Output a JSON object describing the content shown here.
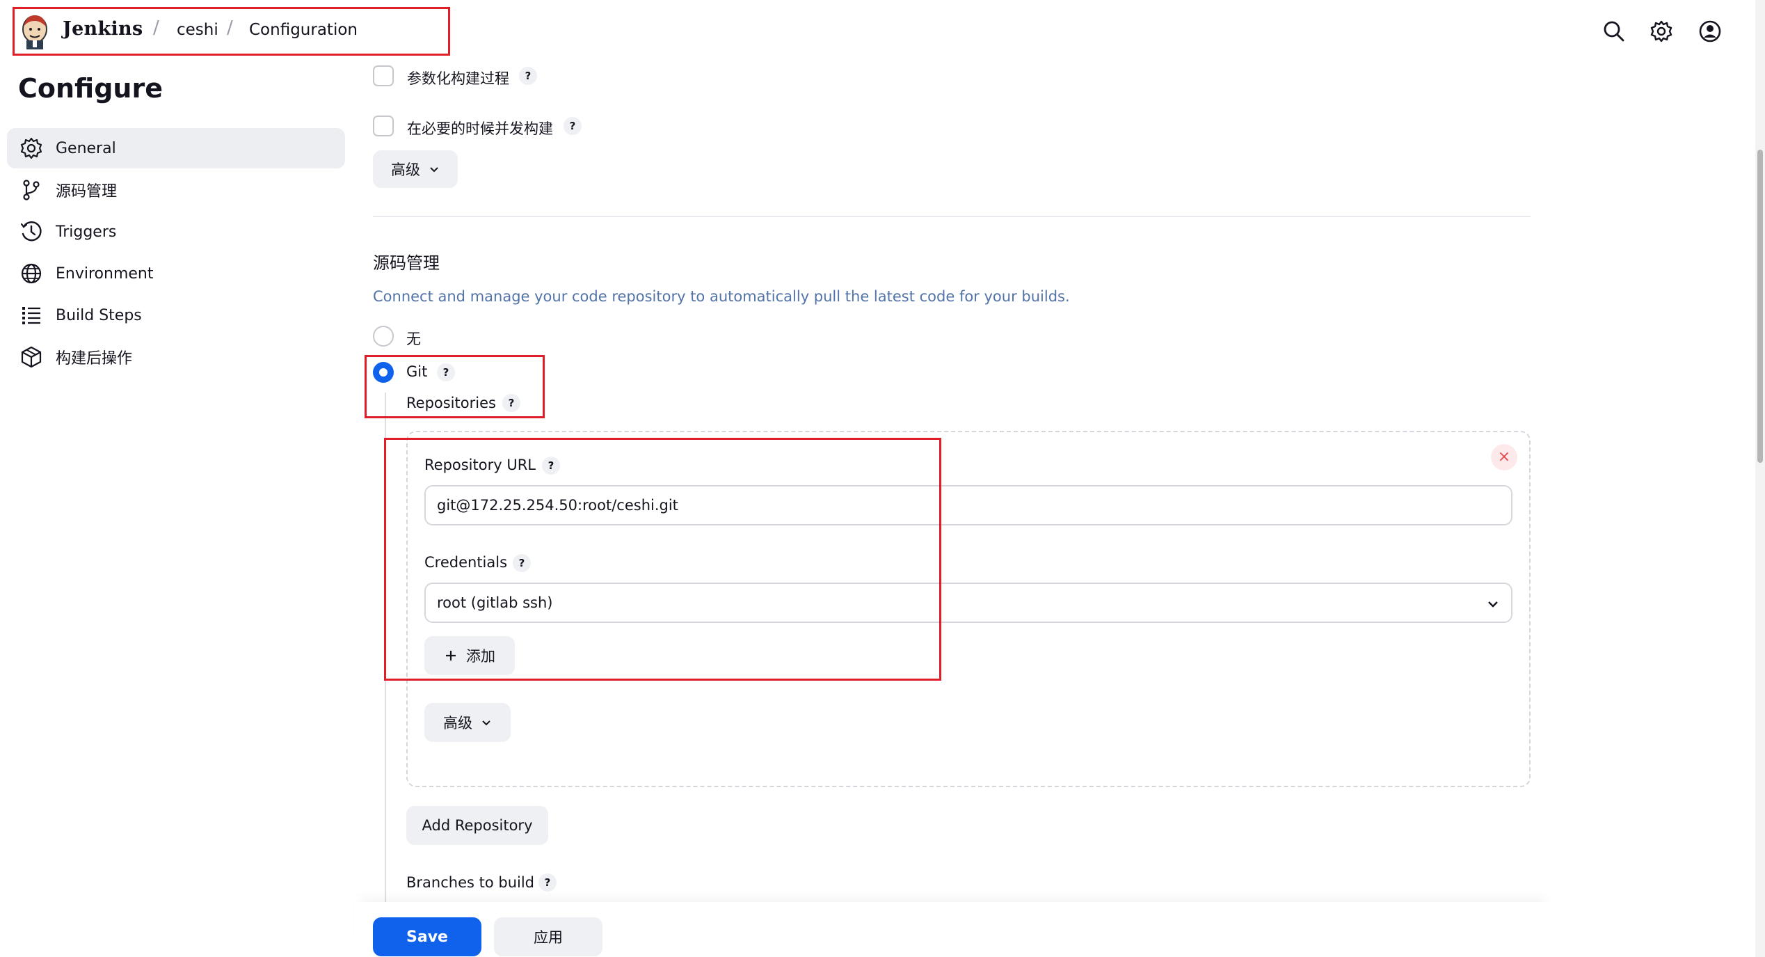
{
  "header": {
    "brand": "Jenkins",
    "breadcrumbs": [
      "ceshi",
      "Configuration"
    ],
    "separator": "/",
    "icons": [
      "search-icon",
      "gear-icon",
      "user-icon"
    ]
  },
  "sidebar": {
    "title": "Configure",
    "items": [
      {
        "label": "General",
        "icon": "gear-icon",
        "active": true
      },
      {
        "label": "源码管理",
        "icon": "branch-icon",
        "active": false
      },
      {
        "label": "Triggers",
        "icon": "clock-icon",
        "active": false
      },
      {
        "label": "Environment",
        "icon": "globe-icon",
        "active": false
      },
      {
        "label": "Build Steps",
        "icon": "list-icon",
        "active": false
      },
      {
        "label": "构建后操作",
        "icon": "cube-icon",
        "active": false
      }
    ]
  },
  "general": {
    "options": [
      {
        "label": "参数化构建过程",
        "checked": false
      },
      {
        "label": "在必要的时候并发构建",
        "checked": false
      }
    ],
    "advanced_label": "高级"
  },
  "scm": {
    "title": "源码管理",
    "description": "Connect and manage your code repository to automatically pull the latest code for your builds.",
    "choices": [
      {
        "label": "无",
        "selected": false
      },
      {
        "label": "Git",
        "selected": true
      }
    ],
    "repositories_label": "Repositories",
    "repository": {
      "url_label": "Repository URL",
      "url_value": "git@172.25.254.50:root/ceshi.git",
      "credentials_label": "Credentials",
      "credentials_value": "root (gitlab ssh)",
      "add_label": "添加",
      "advanced_label": "高级",
      "close_symbol": "×"
    },
    "add_repository_label": "Add Repository",
    "branches_label": "Branches to build"
  },
  "footer": {
    "save_label": "Save",
    "apply_label": "应用"
  },
  "help_symbol": "?",
  "colors": {
    "accent": "#1062ed",
    "highlight": "#e01e2a",
    "danger": "#e5484d",
    "link": "#5273a8"
  }
}
